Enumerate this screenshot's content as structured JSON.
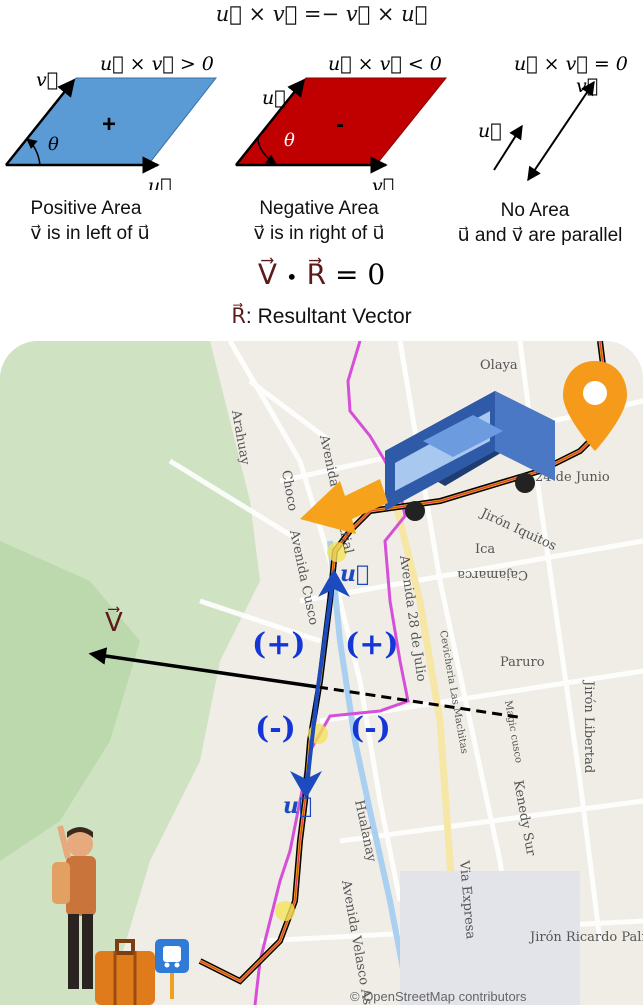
{
  "header": {
    "identity": "u⃗ × v⃗ =− v⃗ × u⃗"
  },
  "panels": [
    {
      "condition": "u⃗ × v⃗ > 0",
      "sign": "+",
      "u_label": "u⃗",
      "v_label": "v⃗",
      "angle": "θ",
      "title": "Positive Area",
      "subtitle": "v⃗ is in left of u⃗",
      "color": "#5b9bd5"
    },
    {
      "condition": "u⃗ × v⃗ < 0",
      "sign": "-",
      "u_label": "u⃗",
      "v_label": "v⃗",
      "angle": "θ",
      "title": "Negative Area",
      "subtitle": "v⃗ is in right of u⃗",
      "color": "#c00000"
    },
    {
      "condition": "u⃗ × v⃗ = 0",
      "u_label": "u⃗",
      "v_label": "v⃗",
      "title": "No Area",
      "subtitle": "u⃗ and v⃗  are parallel"
    }
  ],
  "dot_product": {
    "v": "V⃗",
    "dot": "•",
    "r": "R⃗",
    "eq": "= 0"
  },
  "resultant": {
    "symbol": "R⃗",
    "text": ": Resultant Vector"
  },
  "map": {
    "streets": [
      "Arahuay",
      "Avenida Industrial",
      "Avenida Cusco",
      "Avenida 28 de Julio",
      "24 de Junio",
      "Jirón Iquitos",
      "Ica",
      "Cajamarca",
      "Jirón Libertad",
      "Hualanay",
      "Avenida Velasco Astete",
      "Via Expresa",
      "Kenedy Sur",
      "Jirón Ricardo Palma",
      "Olaya",
      "Choco",
      "Paruro",
      "Cevicheria Las Machitas",
      "Magic cusco"
    ],
    "vector_V_label": "V⃗",
    "u_label_top": "u⃗",
    "u_label_bottom": "u⃗",
    "signs": [
      "(+)",
      "(+)",
      "(-)",
      "(-)"
    ],
    "attribution": "© OpenStreetMap contributors"
  }
}
